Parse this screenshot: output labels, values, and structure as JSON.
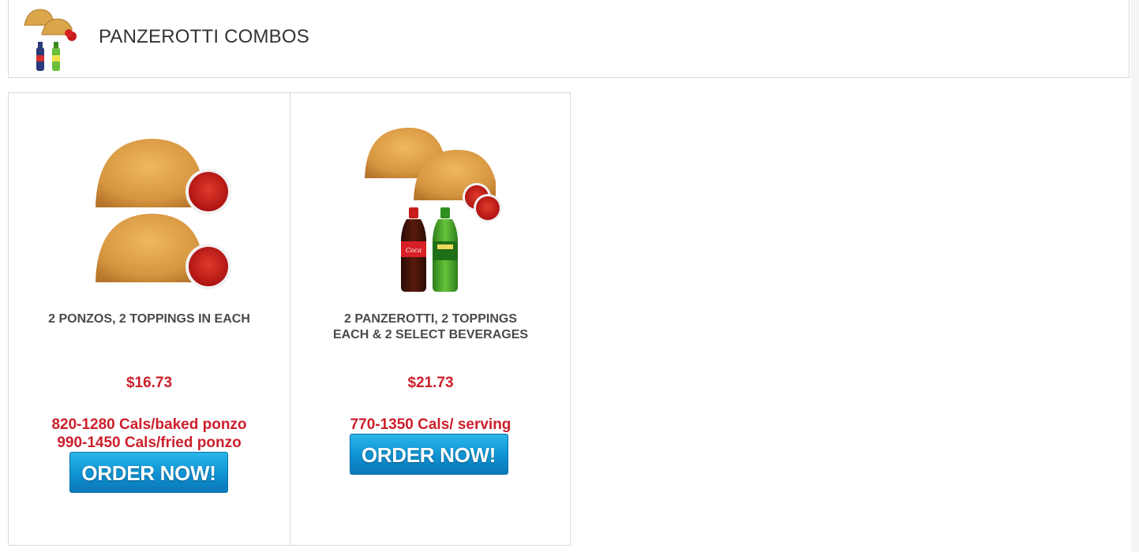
{
  "header": {
    "title": "PANZEROTTI COMBOS",
    "icon": "panzerotti-combo-icon"
  },
  "theme": {
    "price_color": "#cc1f2b",
    "button_color": "#0f92d1",
    "title_color": "#4a4a4a"
  },
  "products": [
    {
      "name": "2 PONZOS, 2 TOPPINGS IN EACH",
      "price": "$16.73",
      "cals_line1": "820-1280 Cals/baked ponzo",
      "cals_line2": "990-1450 Cals/fried ponzo",
      "button_label": "ORDER NOW!",
      "image": "two-ponzos-with-sauce"
    },
    {
      "name_line1": "2 PANZEROTTI, 2 TOPPINGS",
      "name_line2": "EACH & 2 SELECT BEVERAGES",
      "price": "$21.73",
      "cals_line1": "770-1350 Cals/ serving",
      "button_label": "ORDER NOW!",
      "image": "two-panzerotti-with-beverages"
    }
  ]
}
